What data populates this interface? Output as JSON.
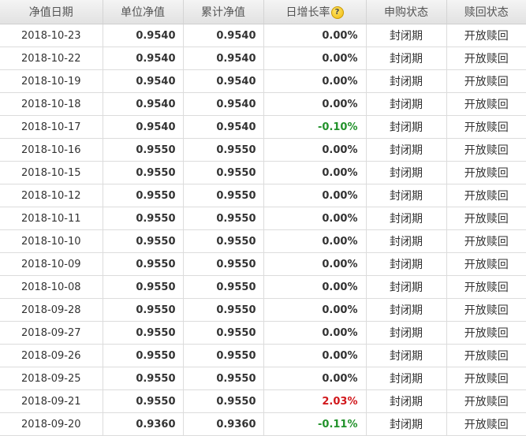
{
  "table": {
    "headers": {
      "date": "净值日期",
      "unit_nav": "单位净值",
      "acc_nav": "累计净值",
      "daily_growth": "日增长率",
      "purchase_status": "申购状态",
      "redeem_status": "赎回状态"
    },
    "help_icon_glyph": "?",
    "colors": {
      "negative": "#22922b",
      "positive": "#d1181c",
      "neutral": "#333333"
    },
    "rows": [
      {
        "date": "2018-10-23",
        "unit_nav": "0.9540",
        "acc_nav": "0.9540",
        "growth": "0.00%",
        "purchase": "封闭期",
        "redeem": "开放赎回"
      },
      {
        "date": "2018-10-22",
        "unit_nav": "0.9540",
        "acc_nav": "0.9540",
        "growth": "0.00%",
        "purchase": "封闭期",
        "redeem": "开放赎回"
      },
      {
        "date": "2018-10-19",
        "unit_nav": "0.9540",
        "acc_nav": "0.9540",
        "growth": "0.00%",
        "purchase": "封闭期",
        "redeem": "开放赎回"
      },
      {
        "date": "2018-10-18",
        "unit_nav": "0.9540",
        "acc_nav": "0.9540",
        "growth": "0.00%",
        "purchase": "封闭期",
        "redeem": "开放赎回"
      },
      {
        "date": "2018-10-17",
        "unit_nav": "0.9540",
        "acc_nav": "0.9540",
        "growth": "-0.10%",
        "purchase": "封闭期",
        "redeem": "开放赎回"
      },
      {
        "date": "2018-10-16",
        "unit_nav": "0.9550",
        "acc_nav": "0.9550",
        "growth": "0.00%",
        "purchase": "封闭期",
        "redeem": "开放赎回"
      },
      {
        "date": "2018-10-15",
        "unit_nav": "0.9550",
        "acc_nav": "0.9550",
        "growth": "0.00%",
        "purchase": "封闭期",
        "redeem": "开放赎回"
      },
      {
        "date": "2018-10-12",
        "unit_nav": "0.9550",
        "acc_nav": "0.9550",
        "growth": "0.00%",
        "purchase": "封闭期",
        "redeem": "开放赎回"
      },
      {
        "date": "2018-10-11",
        "unit_nav": "0.9550",
        "acc_nav": "0.9550",
        "growth": "0.00%",
        "purchase": "封闭期",
        "redeem": "开放赎回"
      },
      {
        "date": "2018-10-10",
        "unit_nav": "0.9550",
        "acc_nav": "0.9550",
        "growth": "0.00%",
        "purchase": "封闭期",
        "redeem": "开放赎回"
      },
      {
        "date": "2018-10-09",
        "unit_nav": "0.9550",
        "acc_nav": "0.9550",
        "growth": "0.00%",
        "purchase": "封闭期",
        "redeem": "开放赎回"
      },
      {
        "date": "2018-10-08",
        "unit_nav": "0.9550",
        "acc_nav": "0.9550",
        "growth": "0.00%",
        "purchase": "封闭期",
        "redeem": "开放赎回"
      },
      {
        "date": "2018-09-28",
        "unit_nav": "0.9550",
        "acc_nav": "0.9550",
        "growth": "0.00%",
        "purchase": "封闭期",
        "redeem": "开放赎回"
      },
      {
        "date": "2018-09-27",
        "unit_nav": "0.9550",
        "acc_nav": "0.9550",
        "growth": "0.00%",
        "purchase": "封闭期",
        "redeem": "开放赎回"
      },
      {
        "date": "2018-09-26",
        "unit_nav": "0.9550",
        "acc_nav": "0.9550",
        "growth": "0.00%",
        "purchase": "封闭期",
        "redeem": "开放赎回"
      },
      {
        "date": "2018-09-25",
        "unit_nav": "0.9550",
        "acc_nav": "0.9550",
        "growth": "0.00%",
        "purchase": "封闭期",
        "redeem": "开放赎回"
      },
      {
        "date": "2018-09-21",
        "unit_nav": "0.9550",
        "acc_nav": "0.9550",
        "growth": "2.03%",
        "purchase": "封闭期",
        "redeem": "开放赎回"
      },
      {
        "date": "2018-09-20",
        "unit_nav": "0.9360",
        "acc_nav": "0.9360",
        "growth": "-0.11%",
        "purchase": "封闭期",
        "redeem": "开放赎回"
      }
    ]
  }
}
